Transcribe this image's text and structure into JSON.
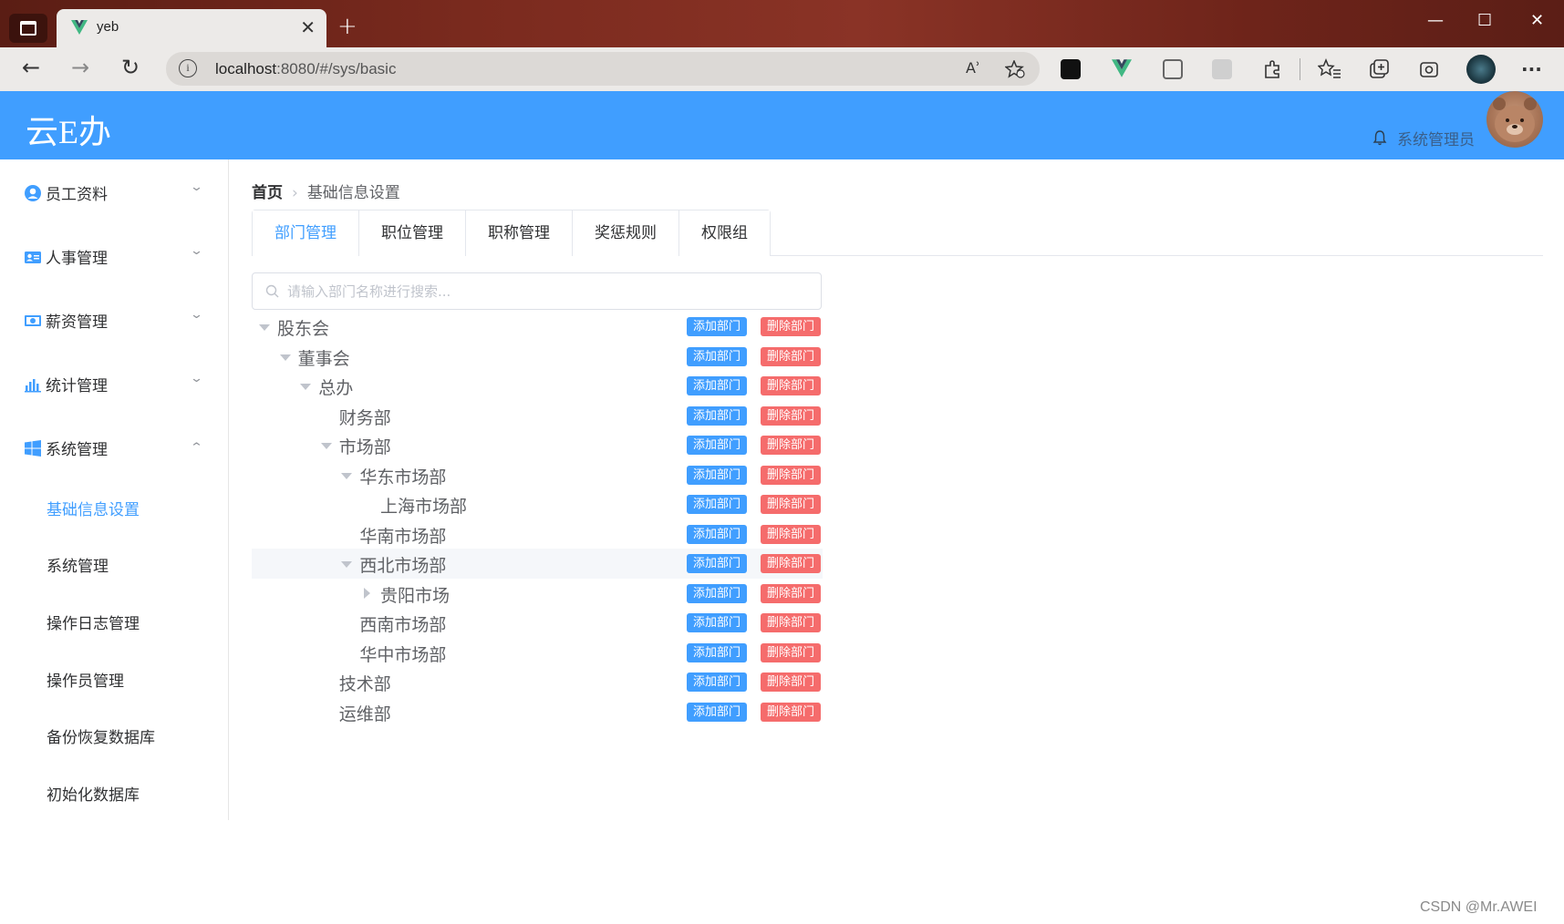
{
  "browser": {
    "tab_title": "yeb",
    "close_glyph": "✕",
    "new_tab_glyph": "+",
    "url_host": "localhost",
    "url_rest": ":8080/#/sys/basic",
    "info_glyph": "i",
    "read_aloud_glyph": "Aʾ",
    "minimize_glyph": "—",
    "maximize_glyph": "☐",
    "close_window_glyph": "✕",
    "back_glyph": "←",
    "forward_glyph": "→",
    "refresh_glyph": "↻",
    "more_glyph": "···"
  },
  "header": {
    "logo": "云E办",
    "username": "系统管理员"
  },
  "sidebar": {
    "menus": [
      {
        "label": "员工资料",
        "icon": "user-circle-icon",
        "arrow": "⌄"
      },
      {
        "label": "人事管理",
        "icon": "id-card-icon",
        "arrow": "⌄"
      },
      {
        "label": "薪资管理",
        "icon": "money-icon",
        "arrow": "⌄"
      },
      {
        "label": "统计管理",
        "icon": "bar-chart-icon",
        "arrow": "⌄"
      },
      {
        "label": "系统管理",
        "icon": "windows-icon",
        "arrow": "⌃"
      }
    ],
    "submenu": [
      {
        "label": "基础信息设置",
        "active": true
      },
      {
        "label": "系统管理"
      },
      {
        "label": "操作日志管理"
      },
      {
        "label": "操作员管理"
      },
      {
        "label": "备份恢复数据库"
      },
      {
        "label": "初始化数据库"
      }
    ]
  },
  "breadcrumb": {
    "home": "首页",
    "separator": "›",
    "current": "基础信息设置"
  },
  "tabs": [
    {
      "label": "部门管理",
      "active": true
    },
    {
      "label": "职位管理"
    },
    {
      "label": "职称管理"
    },
    {
      "label": "奖惩规则"
    },
    {
      "label": "权限组"
    }
  ],
  "search": {
    "placeholder": "请输入部门名称进行搜索...",
    "value": ""
  },
  "tree": {
    "add_label": "添加部门",
    "delete_label": "删除部门",
    "nodes": [
      {
        "label": "股东会",
        "level": 0,
        "caret": "down"
      },
      {
        "label": "董事会",
        "level": 1,
        "caret": "down"
      },
      {
        "label": "总办",
        "level": 2,
        "caret": "down"
      },
      {
        "label": "财务部",
        "level": 3,
        "caret": "none"
      },
      {
        "label": "市场部",
        "level": 3,
        "caret": "down"
      },
      {
        "label": "华东市场部",
        "level": 4,
        "caret": "down"
      },
      {
        "label": "上海市场部",
        "level": 5,
        "caret": "none"
      },
      {
        "label": "华南市场部",
        "level": 4,
        "caret": "none"
      },
      {
        "label": "西北市场部",
        "level": 4,
        "caret": "down",
        "highlight": true
      },
      {
        "label": "贵阳市场",
        "level": 5,
        "caret": "right"
      },
      {
        "label": "西南市场部",
        "level": 4,
        "caret": "none"
      },
      {
        "label": "华中市场部",
        "level": 4,
        "caret": "none"
      },
      {
        "label": "技术部",
        "level": 3,
        "caret": "none"
      },
      {
        "label": "运维部",
        "level": 3,
        "caret": "none"
      }
    ]
  },
  "watermark": "CSDN @Mr.AWEI",
  "colors": {
    "primary": "#409eff",
    "danger": "#f56c6c",
    "header_bg": "#409eff",
    "sidebar_text": "#303133",
    "tree_text": "#606266"
  }
}
